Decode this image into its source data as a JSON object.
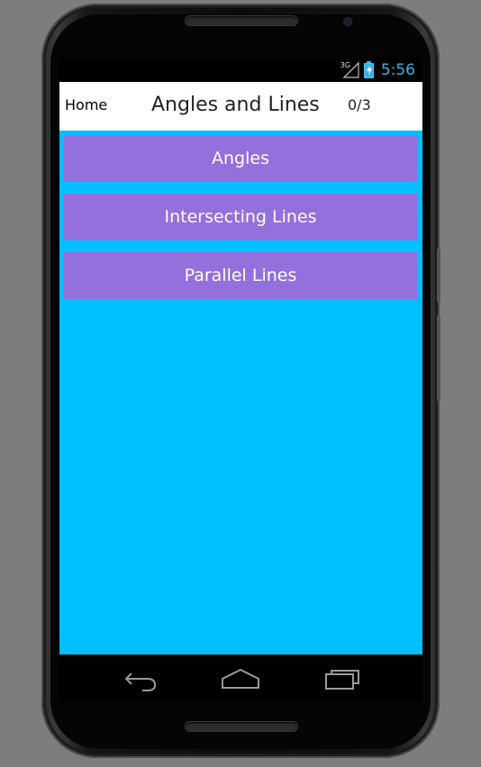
{
  "status_bar": {
    "network": "3G",
    "time": "5:56"
  },
  "header": {
    "home_label": "Home",
    "title": "Angles and Lines",
    "progress": "0/3"
  },
  "topics": [
    {
      "label": "Angles"
    },
    {
      "label": "Intersecting Lines"
    },
    {
      "label": "Parallel Lines"
    }
  ],
  "nav_bar": {
    "icons": [
      "back-icon",
      "home-icon",
      "recent-apps-icon"
    ]
  },
  "colors": {
    "content_background": "#00bfff",
    "topic_button": "#9370db",
    "header_background": "#ffffff",
    "status_accent": "#33b5e5"
  }
}
